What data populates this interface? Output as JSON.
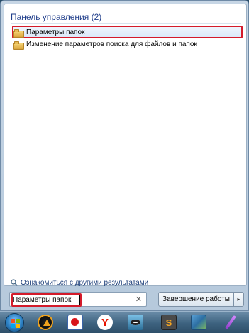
{
  "results": {
    "category_title": "Панель управления (2)",
    "items": [
      {
        "label": "Параметры папок",
        "icon": "folder-options-icon",
        "highlighted": true
      },
      {
        "label": "Изменение параметров поиска для файлов и папок",
        "icon": "folder-options-icon",
        "highlighted": false
      }
    ],
    "more_results": "Ознакомиться с другими результатами"
  },
  "search": {
    "value": "Параметры папок",
    "clear_icon": "close-icon"
  },
  "shutdown": {
    "label": "Завершение работы",
    "arrow": "▸"
  },
  "taskbar": {
    "icons": [
      "start-orb-icon",
      "aimp-icon",
      "paint-icon",
      "yandex-browser-icon",
      "eye-app-icon",
      "sublime-text-icon",
      "photos-icon",
      "feather-icon"
    ],
    "yandex_letter": "Y",
    "sublime_letter": "S"
  },
  "colors": {
    "highlight_border": "#d41b2b",
    "category_text": "#1f3d8a",
    "menu_background": "#c7d6e5"
  }
}
